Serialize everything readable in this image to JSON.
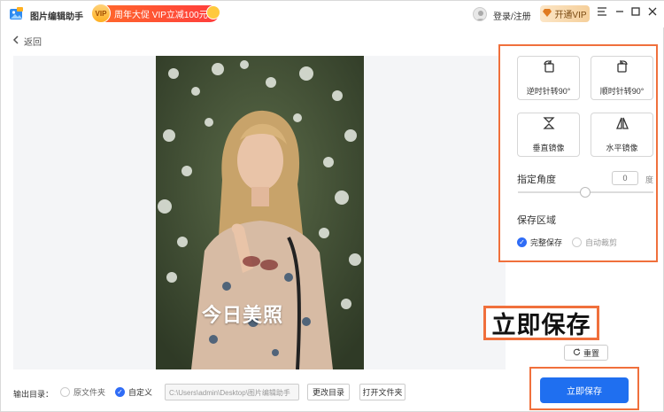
{
  "titlebar": {
    "app_title": "图片编辑助手",
    "promo_badge": "VIP",
    "promo_text": "周年大促 VIP立减100元",
    "login_label": "登录/注册",
    "vip_label": "开通VIP",
    "icons": [
      "app-logo-icon",
      "avatar-icon",
      "diamond-icon",
      "menu-icon",
      "minimize-icon",
      "maximize-icon",
      "close-icon"
    ]
  },
  "nav": {
    "back_label": "返回"
  },
  "image": {
    "overlay_text": "今日美照"
  },
  "panel": {
    "tools": [
      {
        "label": "逆时针转90°",
        "icon": "rotate-ccw-icon"
      },
      {
        "label": "顺时针转90°",
        "icon": "rotate-cw-icon"
      },
      {
        "label": "垂直镜像",
        "icon": "flip-vertical-icon"
      },
      {
        "label": "水平镜像",
        "icon": "flip-horizontal-icon"
      }
    ],
    "angle_label": "指定角度",
    "angle_value": "0",
    "angle_unit": "度",
    "slider_fraction": 0.5,
    "save_area_label": "保存区域",
    "save_options": [
      {
        "label": "完整保存",
        "checked": true
      },
      {
        "label": "自动裁剪",
        "checked": false
      }
    ]
  },
  "callout": {
    "text": "立即保存"
  },
  "actions": {
    "reset_label": "重置",
    "save_now_label": "立即保存"
  },
  "bottom": {
    "output_label": "输出目录：",
    "options": [
      {
        "label": "原文件夹",
        "checked": false
      },
      {
        "label": "自定义",
        "checked": true
      }
    ],
    "path_placeholder": "C:\\Users\\admin\\Desktop\\图片编辑助手",
    "change_dir_label": "更改目录",
    "open_folder_label": "打开文件夹"
  },
  "colors": {
    "accent": "#1f6ff0",
    "highlight": "#f0703c",
    "promo": "#ff4b2b"
  }
}
